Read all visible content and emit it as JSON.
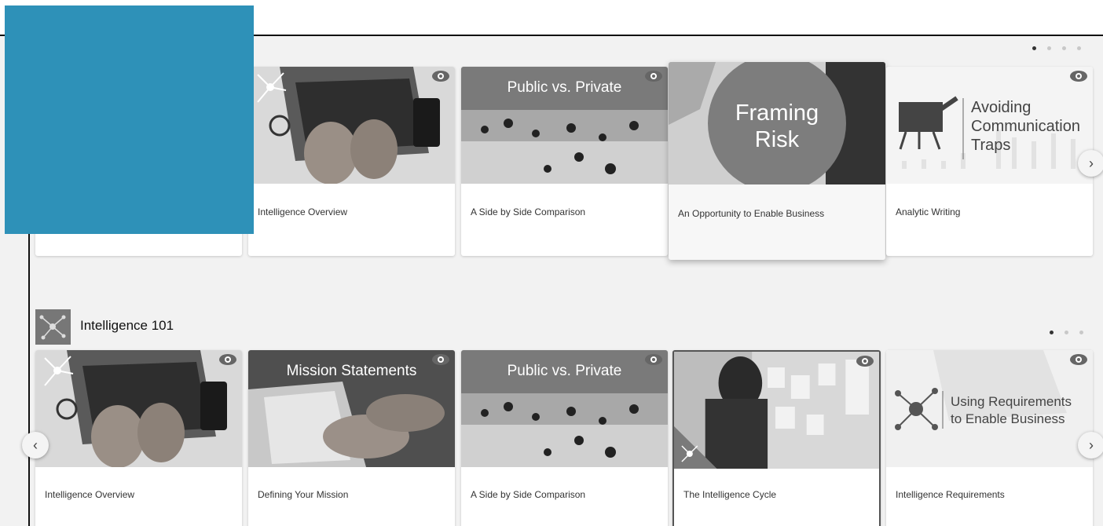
{
  "carousel1": {
    "dots": [
      true,
      false,
      false,
      false
    ],
    "next_arrow": "›",
    "cards": [
      {
        "caption": ""
      },
      {
        "caption": "Intelligence Overview"
      },
      {
        "caption": "A Side by Side Comparison",
        "image_title": "Public vs. Private"
      },
      {
        "caption": "An Opportunity to Enable Business",
        "image_title_line1": "Framing",
        "image_title_line2": "Risk"
      },
      {
        "caption": "Analytic Writing",
        "image_title_line1": "Avoiding",
        "image_title_line2": "Communication",
        "image_title_line3": "Traps"
      }
    ]
  },
  "section2": {
    "title": "Intelligence 101",
    "icon": "network-icon",
    "dots": [
      true,
      false,
      false
    ],
    "prev_arrow": "‹",
    "next_arrow": "›",
    "cards": [
      {
        "caption": "Intelligence Overview"
      },
      {
        "caption": "Defining Your Mission",
        "image_title": "Mission Statements"
      },
      {
        "caption": "A Side by Side Comparison",
        "image_title": "Public vs. Private"
      },
      {
        "caption": "The Intelligence Cycle"
      },
      {
        "caption": "Intelligence Requirements",
        "image_title_line1": "Using Requirements",
        "image_title_line2": "to Enable Business"
      }
    ]
  },
  "colors": {
    "overlay": "#2e91b8",
    "accent_dark": "#111111"
  }
}
